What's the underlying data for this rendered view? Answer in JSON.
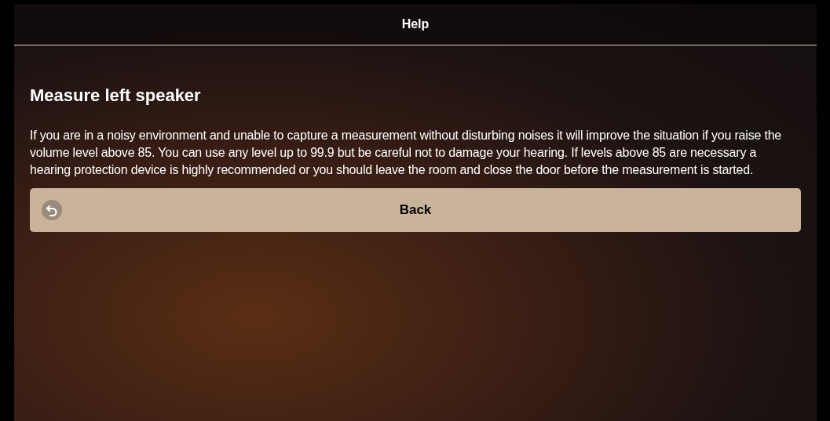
{
  "header": {
    "title": "Help"
  },
  "heading": "Measure left speaker",
  "body": "If you are in a noisy environment and unable to capture a measurement without disturbing noises it will improve the situation if you raise the volume level above 85. You can use any level up to 99.9 but be careful not to damage your hearing. If levels above 85 are necessary a hearing protection device is highly recommended or you should leave the room and close the door before the measurement is started.",
  "button": {
    "label": "Back"
  }
}
